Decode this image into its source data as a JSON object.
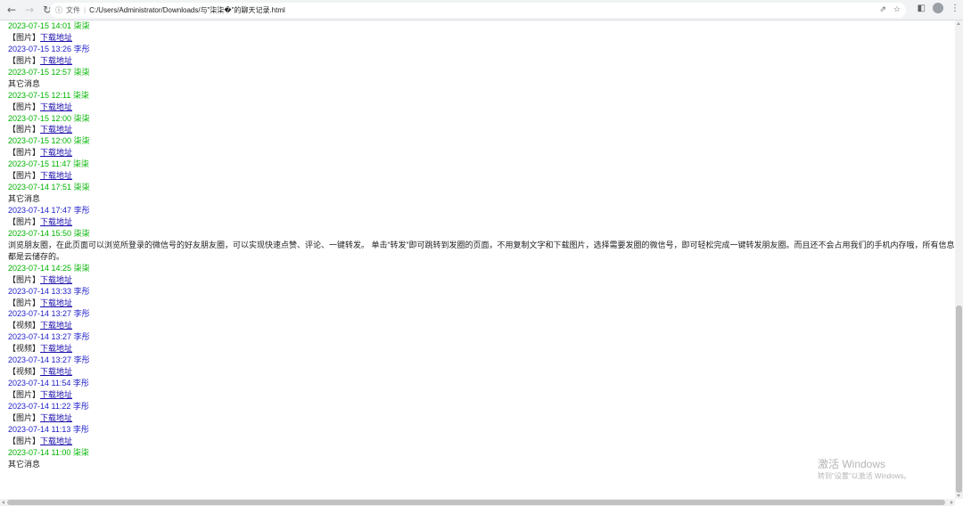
{
  "browser": {
    "page_label": "文件",
    "url": "C:/Users/Administrator/Downloads/与\"柒柒�\"的聊天记录.html",
    "icons": [
      "back-arrow-icon",
      "forward-arrow-icon",
      "reload-icon",
      "info-icon",
      "share-icon",
      "star-icon",
      "side-panel-icon",
      "profile-icon",
      "more-vert-icon"
    ]
  },
  "messages": [
    {
      "time": "2023-07-15 14:01",
      "sender": "柒柒",
      "color": "#00b400",
      "prefix": "【图片】",
      "link": "下载地址",
      "text": ""
    },
    {
      "time": "2023-07-15 13:26",
      "sender": "李彤",
      "color": "#2222cc",
      "prefix": "【图片】",
      "link": "下载地址",
      "text": ""
    },
    {
      "time": "2023-07-15 12:57",
      "sender": "柒柒",
      "color": "#00b400",
      "prefix": "",
      "link": "",
      "text": "其它消息"
    },
    {
      "time": "2023-07-15 12:11",
      "sender": "柒柒",
      "color": "#00b400",
      "prefix": "【图片】",
      "link": "下载地址",
      "text": ""
    },
    {
      "time": "2023-07-15 12:00",
      "sender": "柒柒",
      "color": "#00b400",
      "prefix": "【图片】",
      "link": "下载地址",
      "text": ""
    },
    {
      "time": "2023-07-15 12:00",
      "sender": "柒柒",
      "color": "#00b400",
      "prefix": "【图片】",
      "link": "下载地址",
      "text": ""
    },
    {
      "time": "2023-07-15 11:47",
      "sender": "柒柒",
      "color": "#00b400",
      "prefix": "【图片】",
      "link": "下载地址",
      "text": ""
    },
    {
      "time": "2023-07-14 17:51",
      "sender": "柒柒",
      "color": "#00b400",
      "prefix": "",
      "link": "",
      "text": "其它消息"
    },
    {
      "time": "2023-07-14 17:47",
      "sender": "李彤",
      "color": "#2222cc",
      "prefix": "【图片】",
      "link": "下载地址",
      "text": ""
    },
    {
      "time": "2023-07-14 15:50",
      "sender": "柒柒",
      "color": "#00b400",
      "prefix": "",
      "link": "",
      "text": "浏览朋友圈，在此页面可以浏览所登录的微信号的好友朋友圈，可以实现快速点赞、评论、一键转发。 单击“转发”即可跳转到发圈的页面，不用复制文字和下载图片，选择需要发圈的微信号，即可轻松完成一键转发朋友圈。而且还不会占用我们的手机内存哦，所有信息都是云储存的。"
    },
    {
      "time": "2023-07-14 14:25",
      "sender": "柒柒",
      "color": "#00b400",
      "prefix": "【图片】",
      "link": "下载地址",
      "text": ""
    },
    {
      "time": "2023-07-14 13:33",
      "sender": "李彤",
      "color": "#2222cc",
      "prefix": "【图片】",
      "link": "下载地址",
      "text": ""
    },
    {
      "time": "2023-07-14 13:27",
      "sender": "李彤",
      "color": "#2222cc",
      "prefix": "【视频】",
      "link": "下载地址",
      "text": ""
    },
    {
      "time": "2023-07-14 13:27",
      "sender": "李彤",
      "color": "#2222cc",
      "prefix": "【视频】",
      "link": "下载地址",
      "text": ""
    },
    {
      "time": "2023-07-14 13:27",
      "sender": "李彤",
      "color": "#2222cc",
      "prefix": "【视频】",
      "link": "下载地址",
      "text": ""
    },
    {
      "time": "2023-07-14 11:54",
      "sender": "李彤",
      "color": "#2222cc",
      "prefix": "【图片】",
      "link": "下载地址",
      "text": ""
    },
    {
      "time": "2023-07-14 11:22",
      "sender": "李彤",
      "color": "#2222cc",
      "prefix": "【图片】",
      "link": "下载地址",
      "text": ""
    },
    {
      "time": "2023-07-14 11:13",
      "sender": "李彤",
      "color": "#2222cc",
      "prefix": "【图片】",
      "link": "下载地址",
      "text": ""
    },
    {
      "time": "2023-07-14 11:00",
      "sender": "柒柒",
      "color": "#00b400",
      "prefix": "",
      "link": "",
      "text": "其它消息"
    }
  ],
  "watermark": {
    "title": "激活 Windows",
    "subtitle": "转到\"设置\"以激活 Windows。"
  }
}
